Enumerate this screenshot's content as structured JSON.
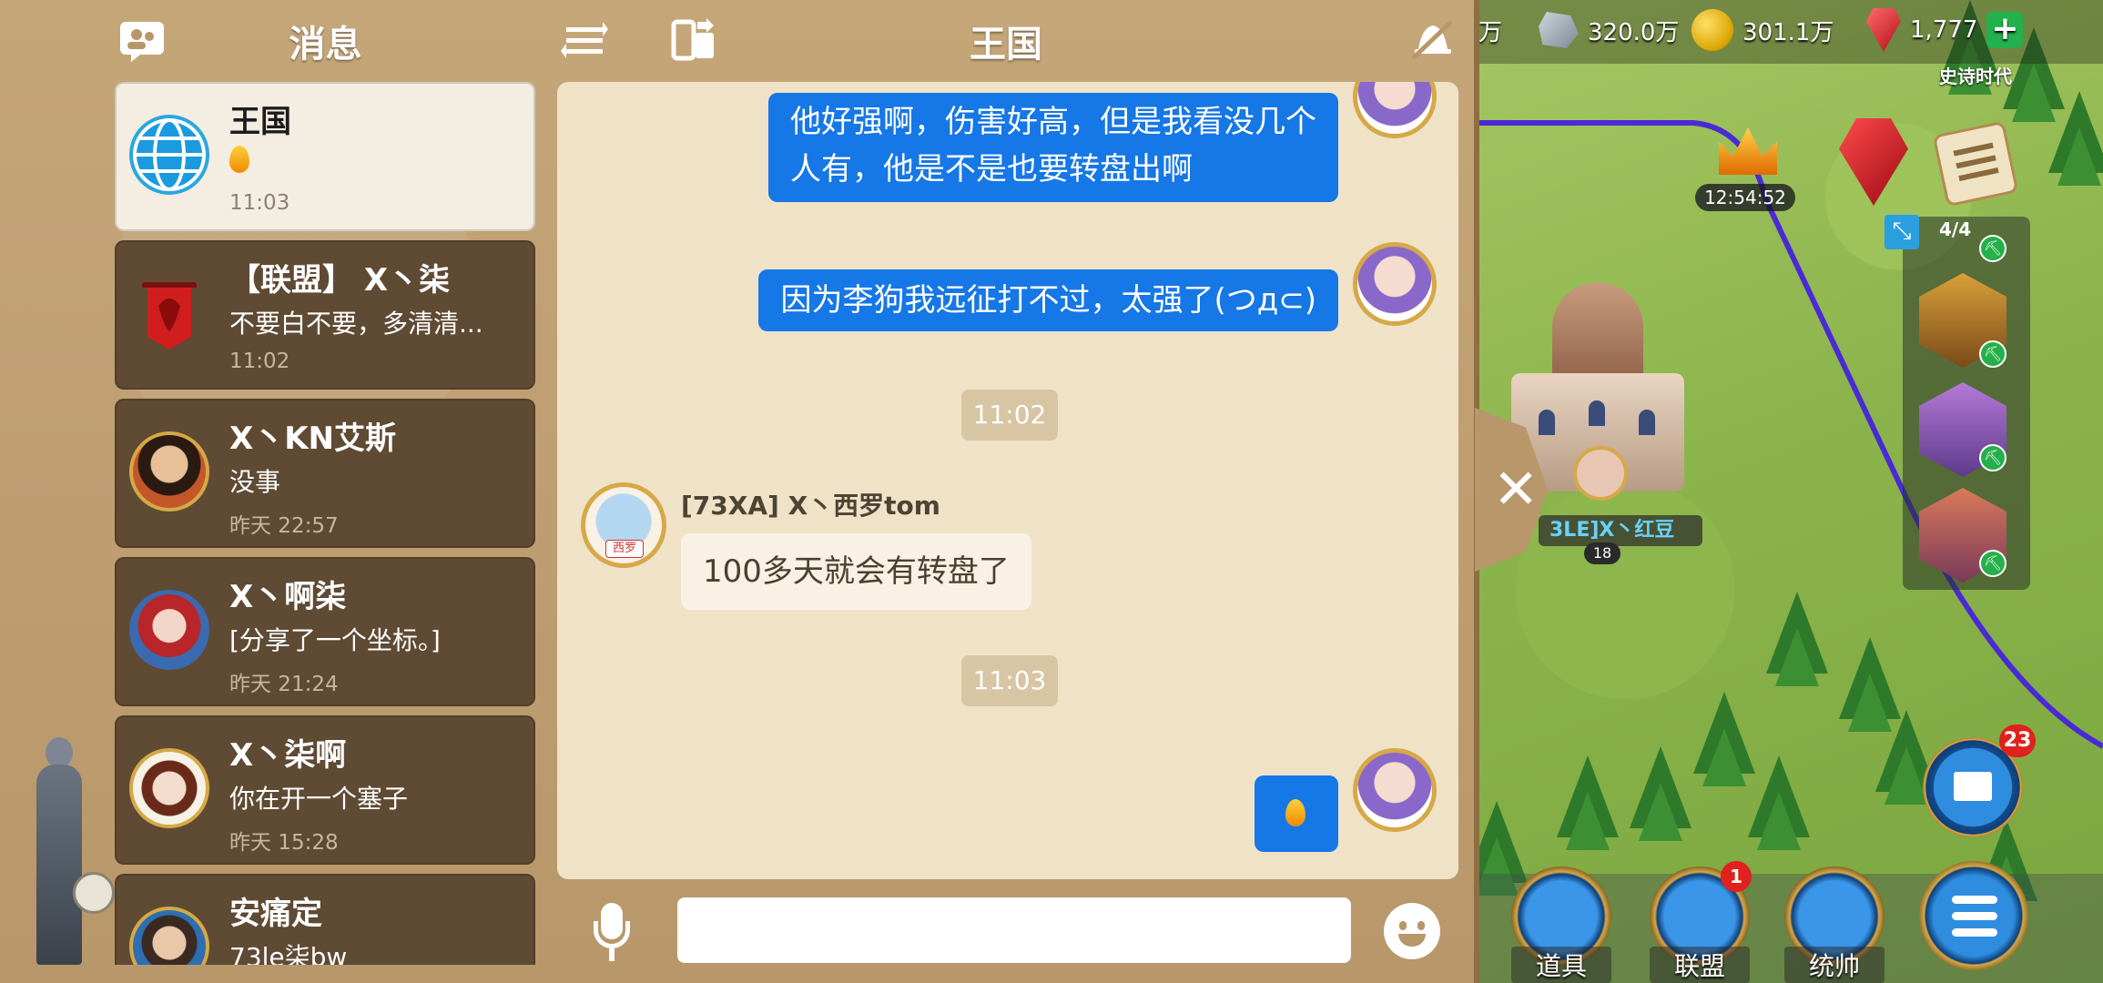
{
  "header": {
    "left_title": "消息",
    "center_title": "王国",
    "icons": [
      "contacts-icon",
      "sort-icon",
      "transfer-icon",
      "bell-off-icon"
    ]
  },
  "conversations": [
    {
      "name": "王国",
      "preview": "🔥",
      "preview_is_icon": true,
      "time": "11:03",
      "active": true,
      "avatar": "globe-icon"
    },
    {
      "name": "【联盟】 X丶柒",
      "preview": "不要白不要，多清清...",
      "time": "11:02",
      "active": false,
      "avatar": "alliance-banner-icon"
    },
    {
      "name": "X丶KN艾斯",
      "preview": "没事",
      "time": "昨天 22:57",
      "active": false,
      "avatar": "avatar"
    },
    {
      "name": "X丶啊柒",
      "preview": "[分享了一个坐标。]",
      "time": "昨天 21:24",
      "active": false,
      "avatar": "avatar"
    },
    {
      "name": "X丶柒啊",
      "preview": "你在开一个塞子",
      "time": "昨天 15:28",
      "active": false,
      "avatar": "avatar"
    },
    {
      "name": "安痛定",
      "preview": "73le柒bw",
      "time": "",
      "active": false,
      "avatar": "avatar"
    }
  ],
  "chat": {
    "messages": [
      {
        "from": "me",
        "lines": [
          "他好强啊，伤害好高，但是我看没几个",
          "人有，他是不是也要转盘出啊"
        ]
      },
      {
        "from": "me",
        "lines": [
          "因为李狗我远征打不过，太强了(つд⊂)"
        ]
      },
      {
        "type": "time",
        "text": "11:02"
      },
      {
        "from": "other",
        "sender": "[73XA] X丶西罗tom",
        "avatar_label": "西罗",
        "lines": [
          "100多天就会有转盘了"
        ]
      },
      {
        "type": "time",
        "text": "11:03"
      },
      {
        "from": "me",
        "emoji": "fire-icon"
      }
    ],
    "input_value": "",
    "input_placeholder": ""
  },
  "game": {
    "resources": [
      {
        "name": "stone",
        "icon": "stone-icon",
        "value": "320.0万"
      },
      {
        "name": "gold",
        "icon": "gold-coin-icon",
        "value": "301.1万"
      },
      {
        "name": "gems",
        "icon": "gem-icon",
        "value": "1,777"
      }
    ],
    "resource_partial": "万",
    "era": "史诗时代",
    "event_timer": "12:54:52",
    "commander_count": "4/4",
    "player_tag": "3LE]X丶红豆",
    "player_level": "18",
    "mail_badge": "23",
    "alliance_badge": "1",
    "bottom_buttons": [
      {
        "label": "道具",
        "icon": "bag-icon"
      },
      {
        "label": "联盟",
        "icon": "alliance-shield-icon"
      },
      {
        "label": "统帅",
        "icon": "helmet-icon"
      }
    ]
  },
  "colors": {
    "bubble_me": "#1677e6",
    "panel_bg": "#b8976a",
    "chat_bg": "#efe2c7",
    "active_conv": "#f4ede1",
    "conv_bg": "#5f4a34"
  }
}
